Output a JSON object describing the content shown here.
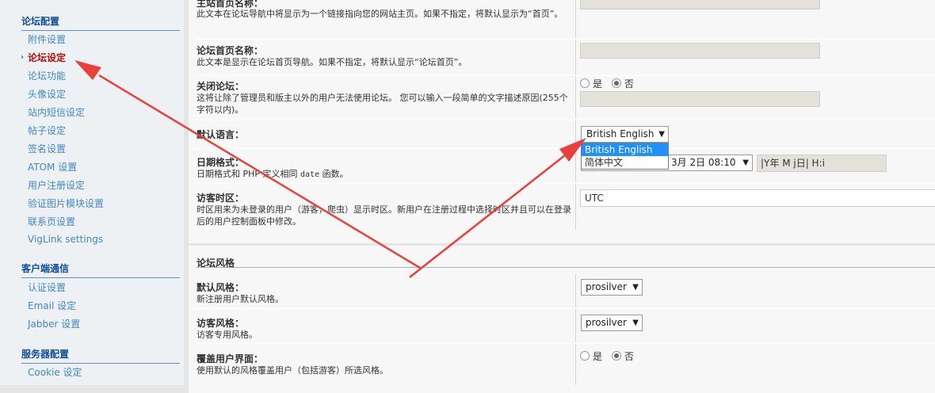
{
  "sidebar": {
    "groups": [
      {
        "title": "论坛配置",
        "items": [
          "附件设置",
          "论坛设定",
          "论坛功能",
          "头像设定",
          "站内短信设定",
          "帖子设定",
          "签名设置",
          "ATOM 设置",
          "用户注册设定",
          "验证图片模块设置",
          "联系页设置",
          "VigLink settings"
        ]
      },
      {
        "title": "客户端通信",
        "items": [
          "认证设置",
          "Email 设定",
          "Jabber 设置"
        ]
      },
      {
        "title": "服务器配置",
        "items": [
          "Cookie 设定"
        ]
      }
    ],
    "active_marker": "›"
  },
  "settings": {
    "site_home_name": {
      "label": "主站首页名称：",
      "desc": "此文本在论坛导航中将显示为一个链接指向您的网站主页。如果不指定，将默认显示为“首页”。"
    },
    "board_index_name": {
      "label": "论坛首页名称：",
      "desc": "此文本是显示在论坛首页导航。如果不指定，将默认显示“论坛首页”。"
    },
    "board_disable": {
      "label": "关闭论坛：",
      "desc": "这将让除了管理员和版主以外的用户无法使用论坛。 您可以输入一段简单的文字描述原因(255个字符以内)。",
      "yes": "是",
      "no": "否",
      "selected": "否"
    },
    "default_lang": {
      "label": "默认语言：",
      "value": "British English",
      "options": [
        "British English",
        "简体中文"
      ],
      "highlighted": "British English"
    },
    "date_format": {
      "label": "日期格式：",
      "desc_pre": "日期格式和 PHP 定义相同 ",
      "desc_code": "date",
      "desc_post": " 函数。",
      "select_value": "3月 2日 08:10",
      "custom_value": "|Y年 M j日| H:i"
    },
    "timezone": {
      "label": "访客时区：",
      "desc": "时区用来为未登录的用户（游客，爬虫）显示时区。新用户在注册过程中选择时区并且可以在登录后的用户控制面板中修改。",
      "value": "UTC"
    }
  },
  "style_section": {
    "title": "论坛风格",
    "default_style": {
      "label": "默认风格：",
      "desc": "新注册用户默认风格。",
      "value": "prosilver"
    },
    "guest_style": {
      "label": "访客风格：",
      "desc": "访客专用风格。",
      "value": "prosilver"
    },
    "override_style": {
      "label": "覆盖用户界面：",
      "desc": "使用默认的风格覆盖用户（包括游客）所选风格。",
      "yes": "是",
      "no": "否",
      "selected": "否"
    }
  },
  "caret": "▼",
  "colors": {
    "annotation_arrow": "#e8413c",
    "dropdown_highlight": "#1e90ff",
    "link": "#4187c6",
    "active_link": "#b30d0d"
  }
}
